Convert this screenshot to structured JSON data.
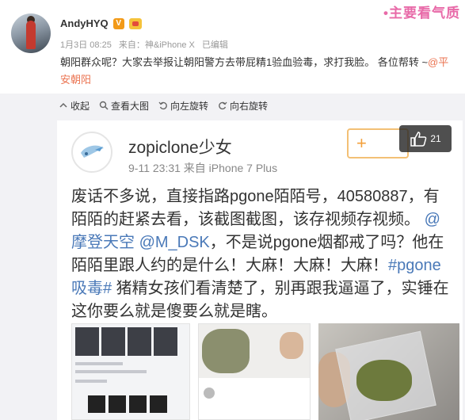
{
  "watermark": "•主要看气质",
  "post": {
    "author": "AndyHYQ",
    "badge_v": "V",
    "date": "1月3日 08:25",
    "source": "来自：神&iPhone X",
    "edited": "已编辑",
    "text": "朝阳群众呢？大家去举报让朝阳警方去带屁精1验血验毒，求打我脸。 各位帮转 ~",
    "mention": "@平安朝阳"
  },
  "toolbar": [
    {
      "label": "收起",
      "icon": "collapse-icon"
    },
    {
      "label": "查看大图",
      "icon": "zoom-icon"
    },
    {
      "label": "向左旋转",
      "icon": "rotate-left-icon"
    },
    {
      "label": "向右旋转",
      "icon": "rotate-right-icon"
    }
  ],
  "embed": {
    "name": "zopiclone少女",
    "time": "9-11 23:31",
    "source": "来自 iPhone 7 Plus",
    "follow": "+",
    "likes": "21",
    "text_a": "废话不多说，直接指路pgone陌陌号，40580887，有陌陌的赶紧去看，该截图截图，该存视频存视频。",
    "mention_1": "@摩登天空",
    "mention_2": "@M_DSK",
    "text_b": "，不是说pgone烟都戒了吗？他在陌陌里跟人约的是什么！大麻！大麻！大麻！",
    "hashtag": "#pgone吸毒#",
    "text_c": " 猪精女孩们看清楚了，别再跟我逼逼了，实锤在这你要么就是傻要么就是瞎。"
  }
}
